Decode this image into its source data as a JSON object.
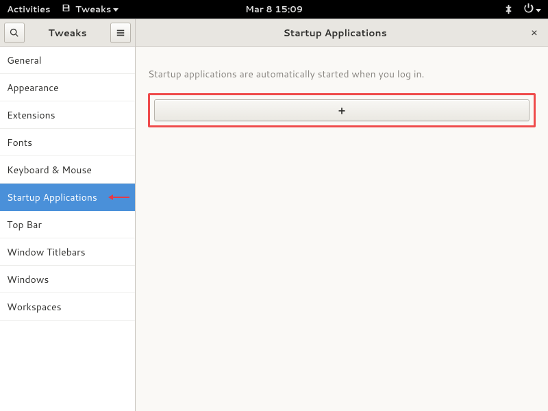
{
  "topbar": {
    "activities": "Activities",
    "app_menu": "Tweaks",
    "clock": "Mar 8  15:09"
  },
  "sidebar": {
    "title": "Tweaks",
    "items": [
      {
        "label": "General"
      },
      {
        "label": "Appearance"
      },
      {
        "label": "Extensions"
      },
      {
        "label": "Fonts"
      },
      {
        "label": "Keyboard & Mouse"
      },
      {
        "label": "Startup Applications"
      },
      {
        "label": "Top Bar"
      },
      {
        "label": "Window Titlebars"
      },
      {
        "label": "Windows"
      },
      {
        "label": "Workspaces"
      }
    ],
    "active_index": 5
  },
  "main": {
    "title": "Startup Applications",
    "close_glyph": "×",
    "description": "Startup applications are automatically started when you log in.",
    "add_glyph": "+"
  }
}
